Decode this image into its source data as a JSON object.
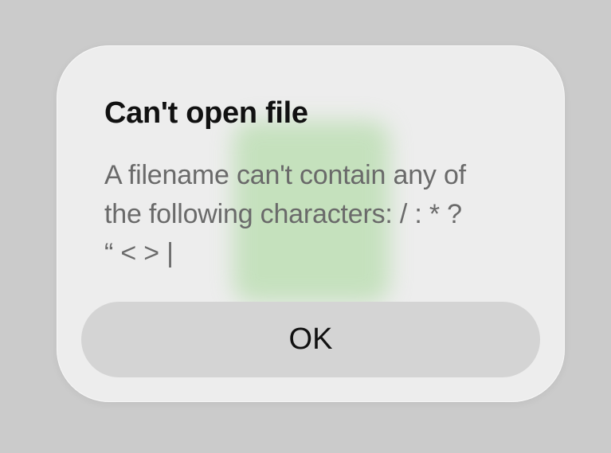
{
  "dialog": {
    "title": "Can't open file",
    "message": "A filename can't contain any of\nthe following characters:  / : * ?\n“ < > |",
    "ok_label": "OK"
  },
  "colors": {
    "background": "#cbcbcb",
    "dialog": "#f0f0f0",
    "button": "#d4d4d4",
    "title_text": "#111111",
    "message_text": "#6a6a6a",
    "blur_tint": "#b8ddae"
  }
}
